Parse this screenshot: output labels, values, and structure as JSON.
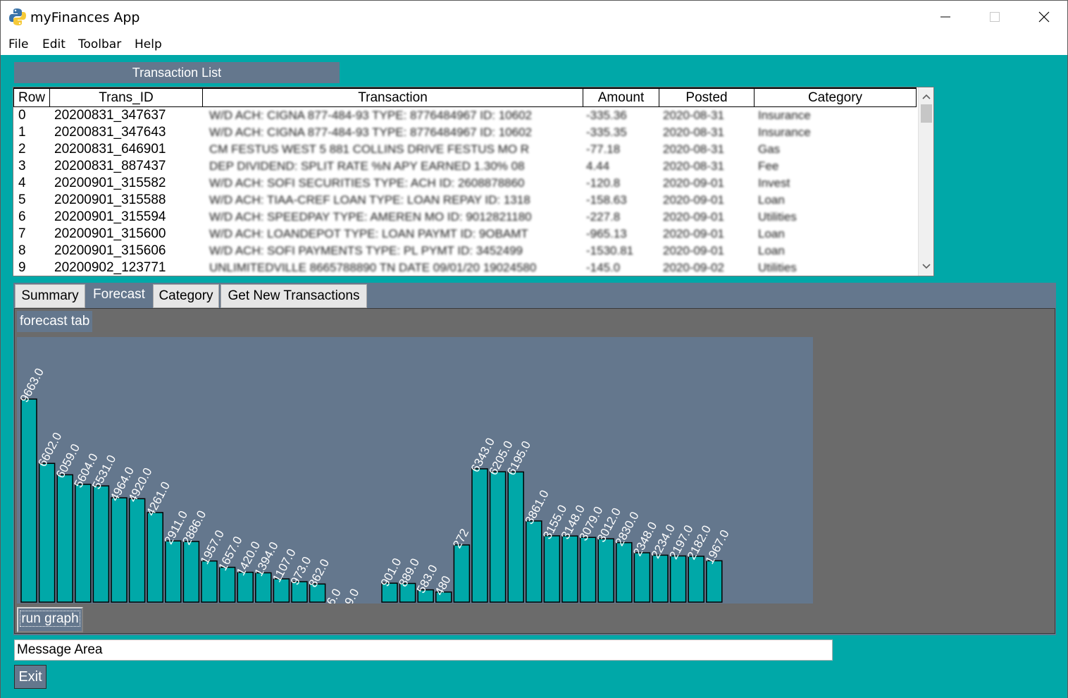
{
  "window": {
    "title": "myFinances App",
    "minimize_glyph": "minimize-icon",
    "maximize_glyph": "maximize-icon",
    "close_glyph": "close-icon"
  },
  "menu": {
    "file": "File",
    "edit": "Edit",
    "toolbar": "Toolbar",
    "help": "Help"
  },
  "transaction_list": {
    "label": "Transaction List",
    "columns": [
      "Row",
      "Trans_ID",
      "Transaction",
      "Amount",
      "Posted",
      "Category"
    ],
    "rows": [
      {
        "row": "0",
        "trans_id": "20200831_347637",
        "transaction": "W/D ACH: CIGNA 877-484-93 TYPE: 8776484967 ID: 10602",
        "amount": "-335.36",
        "posted": "2020-08-31",
        "category": "Insurance"
      },
      {
        "row": "1",
        "trans_id": "20200831_347643",
        "transaction": "W/D ACH: CIGNA 877-484-93 TYPE: 8776484967 ID: 10602",
        "amount": "-335.35",
        "posted": "2020-08-31",
        "category": "Insurance"
      },
      {
        "row": "2",
        "trans_id": "20200831_646901",
        "transaction": "CM FESTUS WEST 5 881 COLLINS DRIVE FESTUS MO R",
        "amount": "-77.18",
        "posted": "2020-08-31",
        "category": "Gas"
      },
      {
        "row": "3",
        "trans_id": "20200831_887437",
        "transaction": "DEP DIVIDEND: SPLIT RATE %N APY EARNED 1.30% 08",
        "amount": "4.44",
        "posted": "2020-08-31",
        "category": "Fee"
      },
      {
        "row": "4",
        "trans_id": "20200901_315582",
        "transaction": "W/D ACH: SOFI SECURITIES TYPE: ACH ID: 2608878860",
        "amount": "-120.8",
        "posted": "2020-09-01",
        "category": "Invest"
      },
      {
        "row": "5",
        "trans_id": "20200901_315588",
        "transaction": "W/D ACH: TIAA-CREF LOAN TYPE: LOAN REPAY ID: 1318",
        "amount": "-158.63",
        "posted": "2020-09-01",
        "category": "Loan"
      },
      {
        "row": "6",
        "trans_id": "20200901_315594",
        "transaction": "W/D ACH: SPEEDPAY TYPE: AMEREN MO ID: 9012821180",
        "amount": "-227.8",
        "posted": "2020-09-01",
        "category": "Utilities"
      },
      {
        "row": "7",
        "trans_id": "20200901_315600",
        "transaction": "W/D ACH: LOANDEPOT TYPE: LOAN PAYMT ID: 9OBAMT",
        "amount": "-965.13",
        "posted": "2020-09-01",
        "category": "Loan"
      },
      {
        "row": "8",
        "trans_id": "20200901_315606",
        "transaction": "W/D ACH: SOFI PAYMENTS TYPE: PL PYMT ID: 3452499",
        "amount": "-1530.81",
        "posted": "2020-09-01",
        "category": "Loan"
      },
      {
        "row": "9",
        "trans_id": "20200902_123771",
        "transaction": "UNLIMITEDVILLE 8665788890 TN DATE 09/01/20 19024580",
        "amount": "-145.0",
        "posted": "2020-09-02",
        "category": "Utilities"
      }
    ]
  },
  "tabs": {
    "summary": "Summary",
    "forecast": "Forecast",
    "category": "Category",
    "get_new": "Get New Transactions",
    "active": "Forecast"
  },
  "forecast": {
    "label": "forecast tab",
    "run_button": "run graph",
    "bar_color": "#00a8a8",
    "background_color": "#64778d"
  },
  "chart_data": {
    "type": "bar",
    "title": "",
    "xlabel": "",
    "ylabel": "",
    "ylim": [
      0,
      12500
    ],
    "values": [
      9663.0,
      6602.0,
      6059.0,
      5604.0,
      5531.0,
      4964.0,
      4920.0,
      4261.0,
      2911.0,
      2886.0,
      1957.0,
      1657.0,
      1420.0,
      1394.0,
      1107.0,
      973.0,
      862.0,
      6.0,
      9.0,
      0,
      901.0,
      889.0,
      583.0,
      480.0,
      2720.0,
      6343.0,
      6205.0,
      6195.0,
      3861.0,
      3155.0,
      3148.0,
      3079.0,
      3012.0,
      2830.0,
      2348.0,
      2234.0,
      2197.0,
      2182.0,
      1967.0
    ],
    "labels": [
      "9663.0",
      "6602.0",
      "6059.0",
      "5604.0",
      "5531.0",
      "4964.0",
      "4920.0",
      "4261.0",
      "2911.0",
      "2886.0",
      "1957.0",
      "1657.0",
      "1420.0",
      "1394.0",
      "1107.0",
      "973.0",
      "862.0",
      "6.0",
      "9.0",
      "",
      "901.0",
      "889.0",
      "583.0",
      "480",
      "272",
      "6343.0",
      "6205.0",
      "6195.0",
      "3861.0",
      "3155.0",
      "3148.0",
      "3079.0",
      "3012.0",
      "2830.0",
      "2348.0",
      "2234.0",
      "2197.0",
      "2182.0",
      "1967.0"
    ]
  },
  "message_area": "Message Area",
  "exit_button": "Exit"
}
